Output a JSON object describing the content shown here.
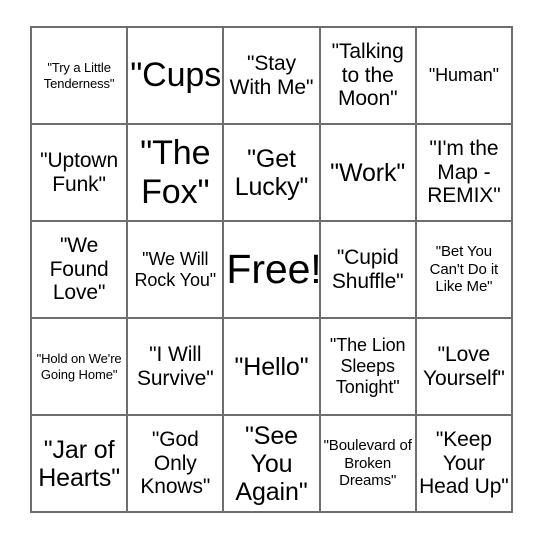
{
  "card": {
    "type": "bingo-card",
    "columns": 5,
    "rows": 5,
    "free_space_index": 12,
    "border_color": "#6e6e6e",
    "text_color": "#000000",
    "background_color": "#ffffff",
    "cells": [
      {
        "text": "\"Try a Little Tenderness\"",
        "size": "xs"
      },
      {
        "text": "\"Cups\"",
        "size": "xxl"
      },
      {
        "text": "\"Stay With Me\"",
        "size": "l"
      },
      {
        "text": "\"Talking to the Moon\"",
        "size": "l"
      },
      {
        "text": "\"Human\"",
        "size": "m"
      },
      {
        "text": "\"Uptown Funk\"",
        "size": "l"
      },
      {
        "text": "\"The Fox\"",
        "size": "xxl"
      },
      {
        "text": "\"Get Lucky\"",
        "size": "xl"
      },
      {
        "text": "\"Work\"",
        "size": "xl"
      },
      {
        "text": "\"I'm the Map - REMIX\"",
        "size": "l"
      },
      {
        "text": "\"We Found Love\"",
        "size": "l"
      },
      {
        "text": "\"We Will Rock You\"",
        "size": "m"
      },
      {
        "text": "Free!",
        "size": "free"
      },
      {
        "text": "\"Cupid Shuffle\"",
        "size": "l"
      },
      {
        "text": "\"Bet You Can't Do it Like Me\"",
        "size": "s"
      },
      {
        "text": "\"Hold on We're Going Home\"",
        "size": "xs"
      },
      {
        "text": "\"I Will Survive\"",
        "size": "l"
      },
      {
        "text": "\"Hello\"",
        "size": "xl"
      },
      {
        "text": "\"The Lion Sleeps Tonight\"",
        "size": "m"
      },
      {
        "text": "\"Love Yourself\"",
        "size": "l"
      },
      {
        "text": "\"Jar of Hearts\"",
        "size": "xl"
      },
      {
        "text": "\"God Only Knows\"",
        "size": "l"
      },
      {
        "text": "\"See You Again\"",
        "size": "xl"
      },
      {
        "text": "\"Boulevard of Broken Dreams\"",
        "size": "s"
      },
      {
        "text": "\"Keep Your Head Up\"",
        "size": "l"
      }
    ]
  }
}
